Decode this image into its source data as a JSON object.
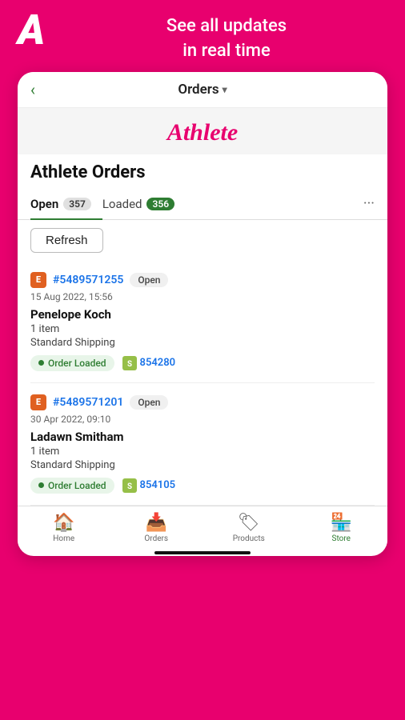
{
  "hero": {
    "logo": "A",
    "tagline_line1": "See all updates",
    "tagline_line2": "in real time"
  },
  "nav": {
    "back_icon": "‹",
    "title": "Orders",
    "dropdown_arrow": "▾"
  },
  "brand": {
    "name": "Athlete"
  },
  "page": {
    "title": "Athlete Orders"
  },
  "tabs": [
    {
      "label": "Open",
      "badge": "357",
      "active": true
    },
    {
      "label": "Loaded",
      "badge": "356",
      "active": false
    }
  ],
  "more_icon": "···",
  "refresh_button": "Refresh",
  "orders": [
    {
      "icon": "E",
      "number": "#5489571255",
      "status": "Open",
      "date": "15 Aug 2022, 15:56",
      "customer": "Penelope Koch",
      "items": "1 item",
      "shipping": "Standard Shipping",
      "loaded": true,
      "shopify_id": "854280"
    },
    {
      "icon": "E",
      "number": "#5489571201",
      "status": "Open",
      "date": "30 Apr 2022, 09:10",
      "customer": "Ladawn Smitham",
      "items": "1 item",
      "shipping": "Standard Shipping",
      "loaded": true,
      "shopify_id": "854105"
    }
  ],
  "bottom_nav": [
    {
      "label": "Home",
      "icon": "🏠",
      "active": false
    },
    {
      "label": "Orders",
      "icon": "📥",
      "active": false
    },
    {
      "label": "Products",
      "icon": "🏷",
      "active": false
    },
    {
      "label": "Store",
      "icon": "🏪",
      "active": true
    }
  ],
  "order_loaded_label": "Order Loaded"
}
